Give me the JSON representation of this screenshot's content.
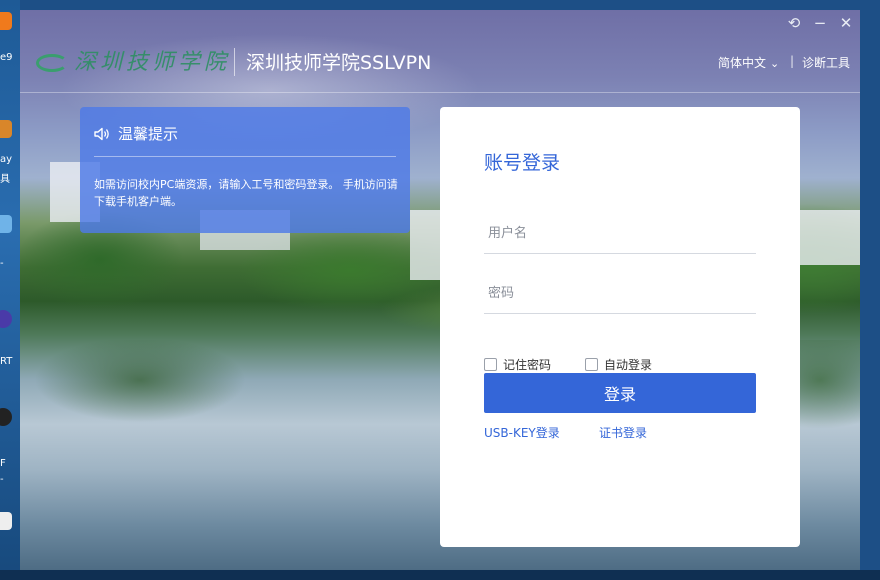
{
  "desktop": {
    "fragments": [
      "e9",
      "ay",
      "具",
      "-",
      "RT",
      "F",
      "-"
    ]
  },
  "window": {
    "logo_script": "深圳技师学院",
    "app_title": "深圳技师学院SSLVPN",
    "controls": {
      "back": "⟲",
      "minimize": "−",
      "close": "✕"
    },
    "language": "简体中文",
    "language_chevron": "⌄",
    "separator": "|",
    "diagnostics": "诊断工具"
  },
  "notice": {
    "title": "温馨提示",
    "body": "如需访问校内PC端资源，请输入工号和密码登录。 手机访问请下载手机客户端。"
  },
  "login": {
    "title": "账号登录",
    "username_placeholder": "用户名",
    "password_placeholder": "密码",
    "remember_label": "记住密码",
    "auto_login_label": "自动登录",
    "submit_label": "登录",
    "usb_key_link": "USB-KEY登录",
    "cert_link": "证书登录"
  },
  "colors": {
    "accent": "#3466d8",
    "notice_bg": "#4e7ae6"
  }
}
